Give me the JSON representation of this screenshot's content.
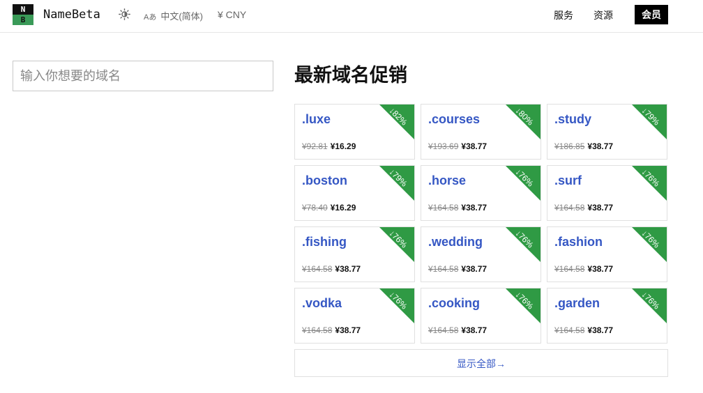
{
  "header": {
    "logo_top": "N",
    "logo_bottom": "B",
    "brand": "NameBeta",
    "lang_glyph": "Aあ",
    "lang_label": "中文(简体)",
    "currency": "¥ CNY",
    "nav": [
      "服务",
      "资源"
    ],
    "member": "会员"
  },
  "search": {
    "placeholder": "输入你想要的域名"
  },
  "promo": {
    "title": "最新域名促销",
    "show_all": "显示全部→",
    "accent": "#2f9a44",
    "link_color": "#3557c4",
    "items": [
      {
        "tld": ".luxe",
        "old": "¥92.81",
        "new": "¥16.29",
        "discount": "↓82%"
      },
      {
        "tld": ".courses",
        "old": "¥193.69",
        "new": "¥38.77",
        "discount": "↓80%"
      },
      {
        "tld": ".study",
        "old": "¥186.85",
        "new": "¥38.77",
        "discount": "↓79%"
      },
      {
        "tld": ".boston",
        "old": "¥78.40",
        "new": "¥16.29",
        "discount": "↓79%"
      },
      {
        "tld": ".horse",
        "old": "¥164.58",
        "new": "¥38.77",
        "discount": "↓76%"
      },
      {
        "tld": ".surf",
        "old": "¥164.58",
        "new": "¥38.77",
        "discount": "↓76%"
      },
      {
        "tld": ".fishing",
        "old": "¥164.58",
        "new": "¥38.77",
        "discount": "↓76%"
      },
      {
        "tld": ".wedding",
        "old": "¥164.58",
        "new": "¥38.77",
        "discount": "↓76%"
      },
      {
        "tld": ".fashion",
        "old": "¥164.58",
        "new": "¥38.77",
        "discount": "↓76%"
      },
      {
        "tld": ".vodka",
        "old": "¥164.58",
        "new": "¥38.77",
        "discount": "↓76%"
      },
      {
        "tld": ".cooking",
        "old": "¥164.58",
        "new": "¥38.77",
        "discount": "↓76%"
      },
      {
        "tld": ".garden",
        "old": "¥164.58",
        "new": "¥38.77",
        "discount": "↓76%"
      }
    ]
  }
}
